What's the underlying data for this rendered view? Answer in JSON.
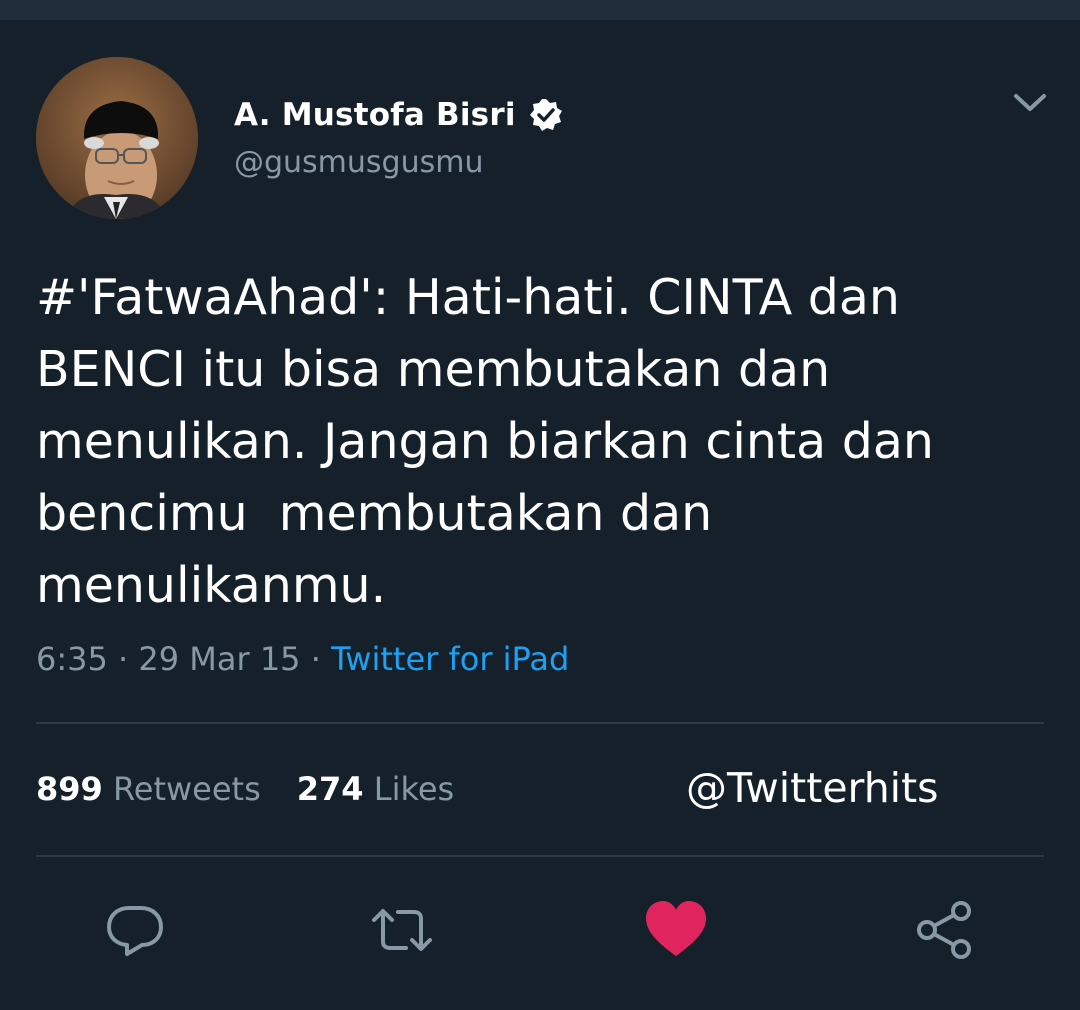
{
  "author": {
    "name": "A. Mustofa Bisri",
    "handle": "@gusmusgusmu",
    "verified": true
  },
  "tweet": {
    "text": "#'FatwaAhad': Hati-hati. CINTA dan\nBENCI itu bisa membutakan dan\nmenulikan. Jangan biarkan cinta dan\nbencimu  membutakan dan\nmenulikanmu.",
    "time": "6:35",
    "date": "29 Mar 15",
    "source": "Twitter for iPad",
    "separator": "·"
  },
  "stats": {
    "retweets_count": "899",
    "retweets_label": "Retweets",
    "likes_count": "274",
    "likes_label": "Likes"
  },
  "watermark": "@Twitterhits",
  "actions": [
    {
      "icon": "reply-icon"
    },
    {
      "icon": "retweet-icon"
    },
    {
      "icon": "heart-icon",
      "active": true
    },
    {
      "icon": "share-icon"
    }
  ],
  "colors": {
    "background": "#15202b",
    "secondary_text": "#8899a6",
    "link": "#1da1f2",
    "like": "#e0245e"
  }
}
